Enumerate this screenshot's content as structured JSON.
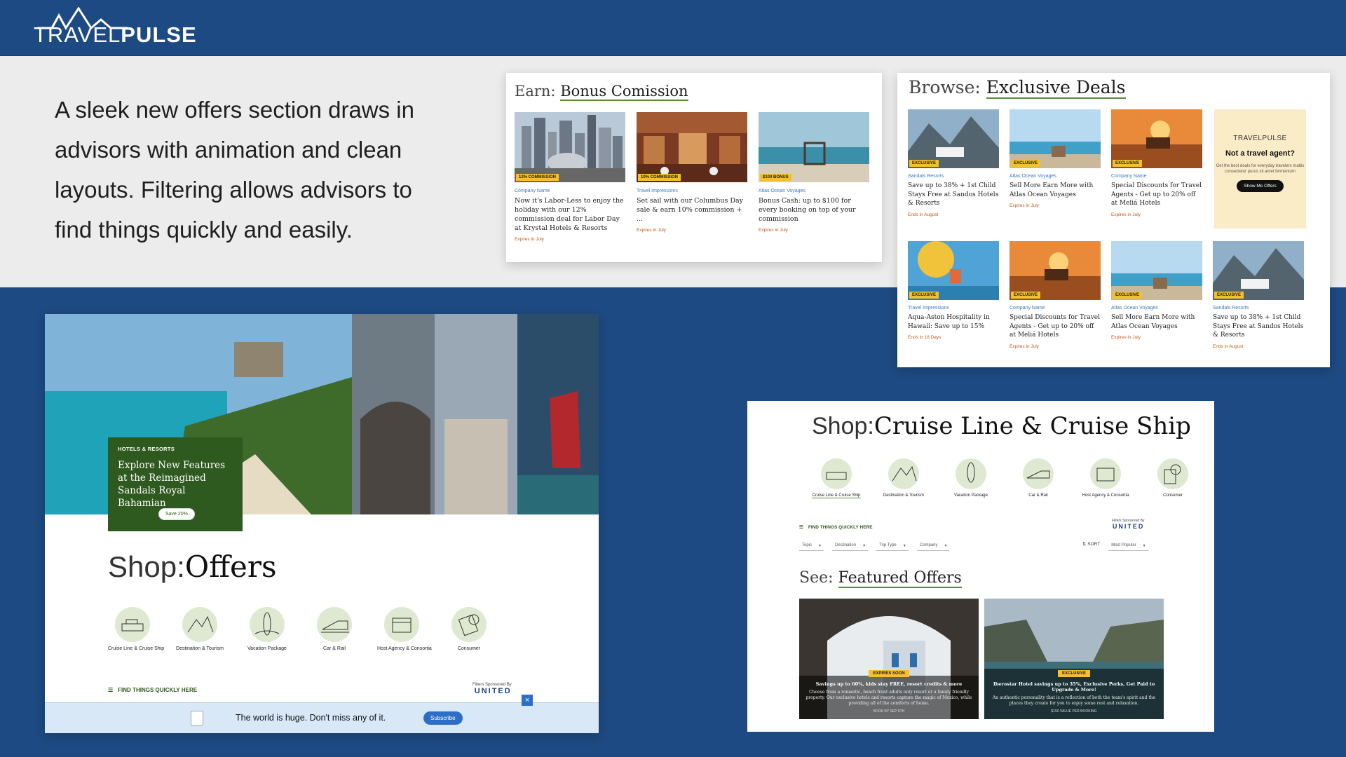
{
  "header": {
    "logo_light": "TRAVEL",
    "logo_bold": "PULSE"
  },
  "intro": {
    "text": "A sleek new offers section draws in advisors with animation and clean layouts. Filtering allows advisors to find things quickly and easily."
  },
  "bonus": {
    "prefix": "Earn:",
    "title": "Bonus Comission",
    "cards": [
      {
        "tag": "12% COMMISSION",
        "meta": "Company Name",
        "text": "Now it's Labor-Less to enjoy the holiday with our 12% commission deal for Labor Day at Krystal Hotels & Resorts",
        "expires": "Expires in July"
      },
      {
        "tag": "10% COMMISSION",
        "meta": "Travel Impressions",
        "text": "Set sail with our Columbus Day sale & earn 10% commission + ...",
        "expires": "Expires in July"
      },
      {
        "tag": "$100 BONUS",
        "meta": "Atlas Ocean Voyages",
        "text": "Bonus Cash: up to $100 for every booking on top of your commission",
        "expires": "Expires in July"
      }
    ]
  },
  "deals": {
    "prefix": "Browse:",
    "title": "Exclusive Deals",
    "cards": [
      {
        "tag": "EXCLUSIVE",
        "meta": "Sandals Resorts",
        "text": "Save up to 38% + 1st Child Stays Free at Sandos Hotels & Resorts",
        "expires": "Ends in August"
      },
      {
        "tag": "EXCLUSIVE",
        "meta": "Atlas Ocean Voyages",
        "text": "Sell More Earn More with Atlas Ocean Voyages",
        "expires": "Expires in July"
      },
      {
        "tag": "EXCLUSIVE",
        "meta": "Company Name",
        "text": "Special Discounts for Travel Agents - Get up to 20% off at Meliá Hotels",
        "expires": "Expires in July"
      },
      {
        "tag": "EXCLUSIVE",
        "meta": "Travel Impressions",
        "text": "Aqua-Aston Hospitality in Hawaii: Save up to 15%",
        "expires": "Ends in 18 Days"
      },
      {
        "tag": "EXCLUSIVE",
        "meta": "Company Name",
        "text": "Special Discounts for Travel Agents - Get up to 20% off at Meliá Hotels",
        "expires": "Expires in July"
      },
      {
        "tag": "EXCLUSIVE",
        "meta": "Atlas Ocean Voyages",
        "text": "Sell More Earn More with Atlas Ocean Voyages",
        "expires": "Expires in July"
      },
      {
        "tag": "EXCLUSIVE",
        "meta": "Sandals Resorts",
        "text": "Save up to 38% + 1st Child Stays Free at Sandos Hotels & Resorts",
        "expires": "Ends in August"
      }
    ],
    "agent": {
      "logo": "TRAVELPULSE",
      "title": "Not a travel agent?",
      "sub": "Get the best deals for everyday travelers mattis consectetur purus sit amet fermentum",
      "button": "Show Me Offers"
    }
  },
  "offers": {
    "hero_kicker": "HOTELS & RESORTS",
    "hero_title": "Explore New Features at the Reimagined Sandals Royal Bahamian",
    "hero_button": "Save 20%",
    "shop_prefix": "Shop:",
    "shop_title": "Offers",
    "categories": [
      "Cruise Line & Cruise Ship",
      "Destination & Tourism",
      "Vacation Package",
      "Car & Rail",
      "Host Agency & Consortia",
      "Consumer"
    ],
    "find_label": "FIND THINGS QUICKLY HERE",
    "sponsor_label": "Filters Sponsored By",
    "sponsor_brand": "UNITED",
    "promo_text": "The world is huge. Don't miss any of it.",
    "promo_button": "Subscribe",
    "close": "×"
  },
  "cruise": {
    "shop_prefix": "Shop:",
    "shop_title": "Cruise Line & Cruise Ship",
    "categories": [
      "Cruise Line & Cruise Ship",
      "Destination & Tourism",
      "Vacation Package",
      "Car & Rail",
      "Host Agency & Consortia",
      "Consumer"
    ],
    "find_label": "FIND THINGS QUICKLY HERE",
    "sponsor_label": "Filters Sponsored By",
    "sponsor_brand": "UNITED",
    "filters": [
      "Topic",
      "Destination",
      "Trip Type",
      "Company"
    ],
    "sort_label": "SORT",
    "sort_value": "Most Popular",
    "see_prefix": "See:",
    "see_title": "Featured Offers",
    "featured": [
      {
        "tag": "EXPIRES SOON",
        "head": "Savings up to 60%, kids stay FREE, resort credits & more",
        "body": "Choose from a romantic, beach front adults only resort or a family friendly property. Our exclusive hotels and resorts capture the magic of Mexico, while providing all of the comforts of home.",
        "foot": "BOOK BY SEP 8TH"
      },
      {
        "tag": "EXCLUSIVE",
        "head": "Iberostar Hotel savings up to 35%, Exclusive Perks, Get Paid to Upgrade & More!",
        "body": "An authentic personality that is a reflection of both the team's spirit and the places they create for you to enjoy some rest and relaxation.",
        "foot": "$150 VALUE PER BOOKING"
      }
    ]
  }
}
